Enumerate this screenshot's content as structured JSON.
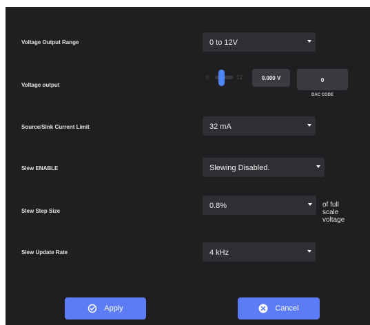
{
  "rows": {
    "voltage_range": {
      "label": "Voltage Output Range",
      "value": "0 to 12V"
    },
    "voltage_output": {
      "label": "Voltage output",
      "slider_min": "0",
      "slider_max": "12",
      "slider_level": 0,
      "voltage_value": "0.000 V",
      "dac_value": "0",
      "dac_caption": "DAC CODE"
    },
    "current_limit": {
      "label": "Source/Sink Current Limit",
      "value": "32 mA"
    },
    "slew_enable": {
      "label": "Slew ENABLE",
      "value": "Slewing Disabled."
    },
    "slew_step": {
      "label": "Slew Step Size",
      "value": "0.8%",
      "note": "of full scale voltage"
    },
    "slew_rate": {
      "label": "Slew Update Rate",
      "value": "4 kHz"
    }
  },
  "buttons": {
    "apply": "Apply",
    "cancel": "Cancel"
  },
  "colors": {
    "panel": "#1f1f22",
    "control": "#2e2e33",
    "accent": "#5b7cf5",
    "slider_thumb": "#4f86f7"
  },
  "icons": {
    "apply": "check-circle-icon",
    "cancel": "close-circle-icon",
    "dropdown": "caret-down-icon"
  }
}
